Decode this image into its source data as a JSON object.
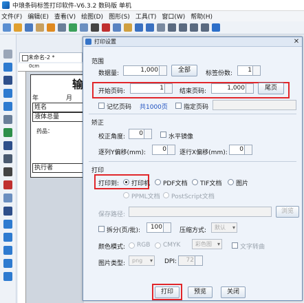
{
  "window": {
    "title": "中琅条码标签打印软件-V6.3.2 数码版 单机"
  },
  "menu": [
    "文件(F)",
    "编辑(E)",
    "查看(V)",
    "绘图(D)",
    "图形(S)",
    "工具(T)",
    "窗口(W)",
    "帮助(H)"
  ],
  "document": {
    "tab_label": "未命名-2 *",
    "ruler_mark": "0cm",
    "label_title": "输",
    "year_month": [
      "年",
      "月"
    ],
    "rows": [
      "姓名",
      "液体总量",
      "执行者"
    ],
    "drug_label": "药品："
  },
  "dialog": {
    "title": "打印设置",
    "range": {
      "section": "范围",
      "quantity_label": "数据量:",
      "quantity_value": "1,000",
      "all_button": "全部",
      "copies_label": "标签份数:",
      "copies_value": "1",
      "start_page_label": "开始页码:",
      "start_page_value": "1",
      "end_page_label": "结束页码:",
      "end_page_value": "1,000",
      "last_page_button": "尾页",
      "remember_page_label": "记忆页码",
      "total_pages": "共1000页",
      "specify_page_label": "指定页码"
    },
    "correction": {
      "section": "矫正",
      "angle_label": "校正角度:",
      "angle_value": "0",
      "mirror_label": "水平镜像",
      "row_y_offset_label": "逐列Y偏移(mm):",
      "row_y_offset_value": "0",
      "row_x_offset_label": "逐行X偏移(mm):",
      "row_x_offset_value": "0"
    },
    "print": {
      "section": "打印",
      "print_to_label": "打印到:",
      "options": [
        "打印机",
        "PDF文档",
        "TIF文档",
        "图片",
        "PPML文档",
        "PostScript文档"
      ],
      "selected": "打印机",
      "save_path_label": "保存路径:",
      "browse_button": "浏览",
      "split_label": "拆分(页/批):",
      "split_value": "100",
      "compression_label": "压缩方式:",
      "compression_value": "默认",
      "color_mode_label": "颜色模式:",
      "color_mode_options": [
        "RGB",
        "CMYK"
      ],
      "color_select_value": "彩色图",
      "text_to_curve_label": "文字转曲",
      "image_type_label": "图片类型:",
      "image_type_value": "png",
      "dpi_label": "DPI:",
      "dpi_value": "72"
    },
    "buttons": {
      "print": "打印",
      "preview": "预览",
      "close": "关闭"
    }
  },
  "colors": {
    "highlight": "#e1262a",
    "accent": "#1d4fbf"
  }
}
